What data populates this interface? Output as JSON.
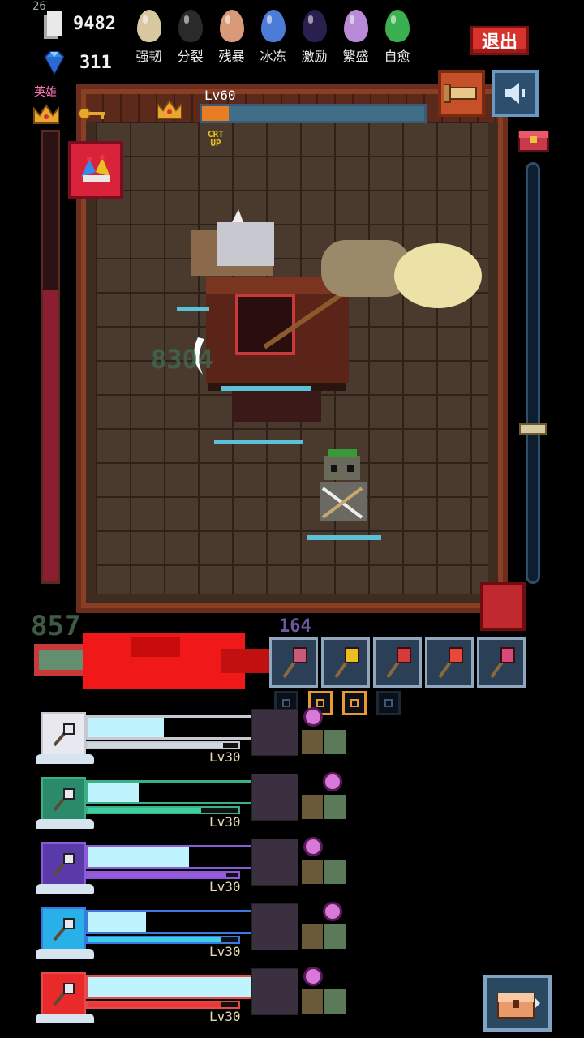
{
  "hud": {
    "fps": "26",
    "gold": "9482",
    "gems": "311",
    "exit_label": "退出"
  },
  "buffs": [
    {
      "label": "强韧",
      "color": "#d9c7a0"
    },
    {
      "label": "分裂",
      "color": "#2a2a2a"
    },
    {
      "label": "残暴",
      "color": "#d89a78"
    },
    {
      "label": "冰冻",
      "color": "#4c7cd8"
    },
    {
      "label": "激励",
      "color": "#2a2050"
    },
    {
      "label": "繁盛",
      "color": "#b88ad8"
    },
    {
      "label": "自愈",
      "color": "#3ab050"
    }
  ],
  "hero": {
    "label": "英雄",
    "hp_fraction": 0.65
  },
  "boss": {
    "level_label": "Lv60",
    "hp_fraction": 0.12
  },
  "crit_badge": {
    "line1": "CRT",
    "line2": "UP"
  },
  "combat": {
    "damage_float": "8304",
    "combo": "857",
    "small_damage": "164"
  },
  "weapons": [
    {
      "name": "crystal-shield-icon"
    },
    {
      "name": "spiked-mace-icon"
    },
    {
      "name": "bow-icon"
    },
    {
      "name": "double-axe-icon"
    },
    {
      "name": "crossed-axes-icon"
    }
  ],
  "slots": [
    false,
    true,
    true,
    false
  ],
  "party": [
    {
      "level": "Lv30",
      "hp": 0.42,
      "sub": 0.9,
      "portrait_bg": "#e8e8f0",
      "sub_color": "#cfd8e0",
      "border": "#c8c8d0"
    },
    {
      "level": "Lv30",
      "hp": 0.28,
      "sub": 0.75,
      "portrait_bg": "#2a8a6a",
      "sub_color": "#3cd0a0",
      "border": "#3ab088"
    },
    {
      "level": "Lv30",
      "hp": 0.56,
      "sub": 0.92,
      "portrait_bg": "#5a3aa8",
      "sub_color": "#9a5ae0",
      "border": "#8a5ad8"
    },
    {
      "level": "Lv30",
      "hp": 0.32,
      "sub": 0.88,
      "portrait_bg": "#2ab0e8",
      "sub_color": "#3ad0e8",
      "border": "#3a7ae0"
    },
    {
      "level": "Lv30",
      "hp": 0.9,
      "sub": 0.88,
      "portrait_bg": "#e82a2a",
      "sub_color": "#e83a3a",
      "border": "#e84a4a"
    }
  ],
  "right_slider_fraction": 0.62
}
